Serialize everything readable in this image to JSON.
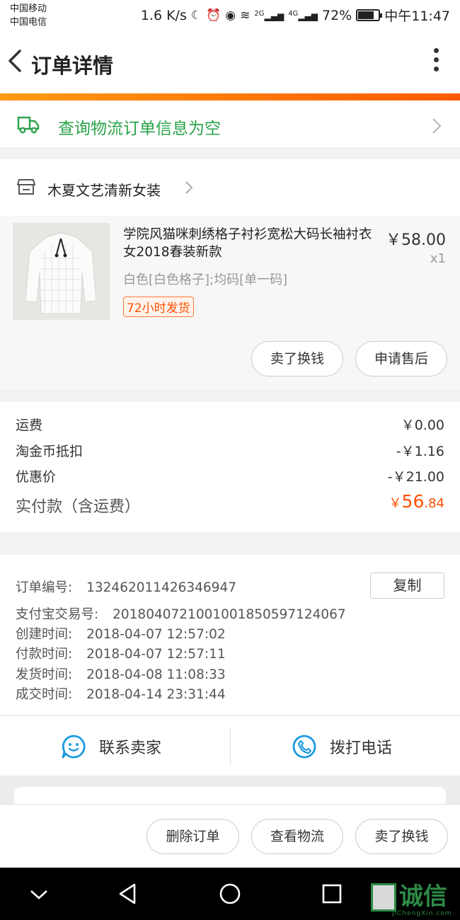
{
  "status": {
    "carrier1": "中国移动",
    "carrier2": "中国电信",
    "speed": "1.6 K/s",
    "net1": "2G",
    "net2": "4G",
    "battery": "72%",
    "time": "中午11:47"
  },
  "header": {
    "title": "订单详情"
  },
  "logistics": {
    "text": "查询物流订单信息为空"
  },
  "shop": {
    "name": "木夏文艺清新女装"
  },
  "product": {
    "title": "学院风猫咪刺绣格子衬衫宽松大码长袖衬衣女2018春装新款",
    "price": "￥58.00",
    "quantity": "x1",
    "spec": "白色[白色格子];均码[单一码]",
    "tag": "72小时发货",
    "actions": [
      "卖了换钱",
      "申请售后"
    ]
  },
  "fees": {
    "shipping_label": "运费",
    "shipping_value": "￥0.00",
    "coin_label": "淘金币抵扣",
    "coin_value": "-￥1.16",
    "discount_label": "优惠价",
    "discount_value": "-￥21.00",
    "paid_label": "实付款（含运费）",
    "paid_currency": "￥",
    "paid_int": "56",
    "paid_dec": ".84"
  },
  "order_info": {
    "order_no_label": "订单编号:",
    "order_no": "132462011426346947",
    "copy_label": "复制",
    "alipay_label": "支付宝交易号:",
    "alipay_no": "2018040721001001850597124067",
    "created_label": "创建时间:",
    "created": "2018-04-07 12:57:02",
    "paid_time_label": "付款时间:",
    "paid_time": "2018-04-07 12:57:11",
    "shipped_label": "发货时间:",
    "shipped": "2018-04-08 11:08:33",
    "done_label": "成交时间:",
    "done": "2018-04-14 23:31:44"
  },
  "contact": {
    "seller": "联系卖家",
    "phone": "拨打电话"
  },
  "bottom_actions": [
    "删除订单",
    "查看物流",
    "卖了换钱"
  ],
  "watermark": {
    "text": "诚信",
    "sub": "JiChengXin.com"
  },
  "colors": {
    "accent": "#ff5000",
    "green": "#2aa34a",
    "blue": "#1a9ae0"
  }
}
